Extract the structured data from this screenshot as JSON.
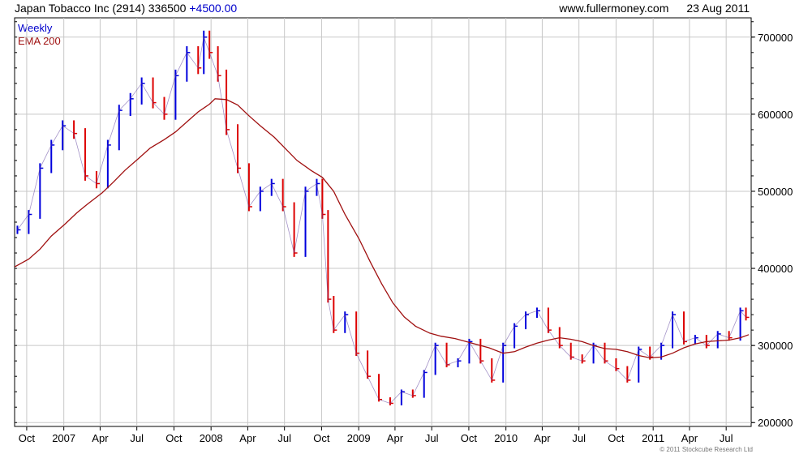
{
  "header": {
    "company": "Japan Tobacco Inc (2914)",
    "last": "336500",
    "change": "+4500.00",
    "site": "www.fullermoney.com",
    "date": "23 Aug 2011"
  },
  "legend": {
    "weekly": "Weekly",
    "ema": "EMA 200"
  },
  "footer": "© 2011 Stockcube Research Ltd",
  "colors": {
    "up": "#0000dd",
    "down": "#dd0000",
    "ema": "#a01010",
    "grid": "#c8c8c8"
  },
  "chart_data": {
    "type": "line",
    "title": "Japan Tobacco Inc (2914)",
    "xlabel": "",
    "ylabel": "",
    "xlim": [
      "2006-09-01",
      "2011-09-01"
    ],
    "ylim": [
      195000,
      725000
    ],
    "y_ticks": [
      200000,
      300000,
      400000,
      500000,
      600000,
      700000
    ],
    "y_tick_labels": [
      "200000",
      "300000",
      "400000",
      "500000",
      "600000",
      "700000"
    ],
    "x_ticks": [
      {
        "date": "2006-10-01",
        "label": "Oct"
      },
      {
        "date": "2007-01-01",
        "label": "2007"
      },
      {
        "date": "2007-04-01",
        "label": "Apr"
      },
      {
        "date": "2007-07-01",
        "label": "Jul"
      },
      {
        "date": "2007-10-01",
        "label": "Oct"
      },
      {
        "date": "2008-01-01",
        "label": "2008"
      },
      {
        "date": "2008-04-01",
        "label": "Apr"
      },
      {
        "date": "2008-07-01",
        "label": "Jul"
      },
      {
        "date": "2008-10-01",
        "label": "Oct"
      },
      {
        "date": "2009-01-01",
        "label": "2009"
      },
      {
        "date": "2009-04-01",
        "label": "Apr"
      },
      {
        "date": "2009-07-01",
        "label": "Jul"
      },
      {
        "date": "2009-10-01",
        "label": "Oct"
      },
      {
        "date": "2010-01-01",
        "label": "2010"
      },
      {
        "date": "2010-04-01",
        "label": "Apr"
      },
      {
        "date": "2010-07-01",
        "label": "Jul"
      },
      {
        "date": "2010-10-01",
        "label": "Oct"
      },
      {
        "date": "2011-01-01",
        "label": "2011"
      },
      {
        "date": "2011-04-01",
        "label": "Apr"
      },
      {
        "date": "2011-07-01",
        "label": "Jul"
      }
    ],
    "grid": true,
    "y_axis_position": "right",
    "series": [
      {
        "name": "Weekly",
        "style": "price-bars",
        "x": [
          "2006-09-08",
          "2006-10-06",
          "2006-11-03",
          "2006-12-01",
          "2006-12-29",
          "2007-01-26",
          "2007-02-23",
          "2007-03-23",
          "2007-04-20",
          "2007-05-18",
          "2007-06-15",
          "2007-07-13",
          "2007-08-10",
          "2007-09-07",
          "2007-10-05",
          "2007-11-02",
          "2007-11-30",
          "2007-12-14",
          "2007-12-28",
          "2008-01-18",
          "2008-02-08",
          "2008-03-07",
          "2008-04-04",
          "2008-05-02",
          "2008-05-30",
          "2008-06-27",
          "2008-07-25",
          "2008-08-22",
          "2008-09-19",
          "2008-10-03",
          "2008-10-17",
          "2008-10-31",
          "2008-11-28",
          "2008-12-26",
          "2009-01-23",
          "2009-02-20",
          "2009-03-20",
          "2009-04-17",
          "2009-05-15",
          "2009-06-12",
          "2009-07-10",
          "2009-08-07",
          "2009-09-04",
          "2009-10-02",
          "2009-10-30",
          "2009-11-27",
          "2009-12-25",
          "2010-01-22",
          "2010-02-19",
          "2010-03-19",
          "2010-04-16",
          "2010-05-14",
          "2010-06-11",
          "2010-07-09",
          "2010-08-06",
          "2010-09-03",
          "2010-10-01",
          "2010-10-29",
          "2010-11-26",
          "2010-12-24",
          "2011-01-21",
          "2011-02-18",
          "2011-03-18",
          "2011-04-15",
          "2011-05-13",
          "2011-06-10",
          "2011-07-08",
          "2011-08-05",
          "2011-08-19"
        ],
        "values": [
          450000,
          470000,
          530000,
          560000,
          585000,
          575000,
          520000,
          510000,
          560000,
          605000,
          620000,
          640000,
          615000,
          600000,
          650000,
          680000,
          660000,
          700000,
          680000,
          650000,
          580000,
          530000,
          480000,
          500000,
          510000,
          480000,
          420000,
          500000,
          510000,
          470000,
          360000,
          320000,
          340000,
          290000,
          260000,
          230000,
          225000,
          240000,
          235000,
          265000,
          300000,
          275000,
          280000,
          305000,
          280000,
          255000,
          300000,
          325000,
          340000,
          345000,
          320000,
          300000,
          285000,
          280000,
          300000,
          280000,
          270000,
          255000,
          295000,
          285000,
          300000,
          340000,
          305000,
          310000,
          300000,
          315000,
          310000,
          345000,
          336500
        ]
      },
      {
        "name": "EMA 200",
        "style": "line",
        "x": [
          "2006-09-01",
          "2006-10-06",
          "2006-11-03",
          "2006-12-01",
          "2007-01-05",
          "2007-02-02",
          "2007-03-02",
          "2007-04-06",
          "2007-05-04",
          "2007-06-01",
          "2007-07-06",
          "2007-08-03",
          "2007-09-07",
          "2007-10-05",
          "2007-11-02",
          "2007-11-30",
          "2007-12-28",
          "2008-01-11",
          "2008-02-08",
          "2008-03-07",
          "2008-04-04",
          "2008-05-02",
          "2008-06-06",
          "2008-07-04",
          "2008-08-01",
          "2008-09-05",
          "2008-10-03",
          "2008-10-31",
          "2008-11-28",
          "2009-01-02",
          "2009-01-30",
          "2009-02-27",
          "2009-03-27",
          "2009-04-24",
          "2009-05-22",
          "2009-06-26",
          "2009-07-24",
          "2009-08-28",
          "2009-09-25",
          "2009-10-23",
          "2009-11-20",
          "2009-12-25",
          "2010-01-22",
          "2010-02-19",
          "2010-03-19",
          "2010-04-16",
          "2010-05-14",
          "2010-06-11",
          "2010-07-09",
          "2010-08-06",
          "2010-09-03",
          "2010-10-01",
          "2010-10-29",
          "2010-11-26",
          "2010-12-24",
          "2011-01-21",
          "2011-02-18",
          "2011-03-18",
          "2011-04-15",
          "2011-05-13",
          "2011-06-10",
          "2011-07-08",
          "2011-08-05",
          "2011-08-26"
        ],
        "values": [
          402000,
          412000,
          425000,
          442000,
          458000,
          472000,
          484000,
          498000,
          512000,
          527000,
          543000,
          556000,
          567000,
          577000,
          590000,
          603000,
          613000,
          620000,
          619000,
          612000,
          598000,
          585000,
          570000,
          555000,
          540000,
          527000,
          518000,
          500000,
          470000,
          438000,
          408000,
          380000,
          355000,
          337000,
          325000,
          316000,
          312000,
          309000,
          305000,
          301000,
          297000,
          290000,
          292000,
          298000,
          303000,
          307000,
          310000,
          308000,
          305000,
          300000,
          296000,
          295000,
          292000,
          287000,
          284000,
          285000,
          290000,
          297000,
          302000,
          305000,
          306000,
          307000,
          310000,
          314000
        ]
      }
    ]
  }
}
